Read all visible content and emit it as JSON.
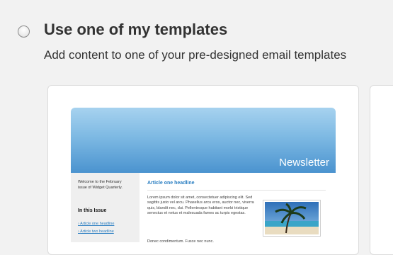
{
  "option": {
    "title": "Use one of my templates",
    "subtitle": "Add content to one of your pre-designed email templates"
  },
  "template_preview": {
    "header_title": "Newsletter",
    "sidebar": {
      "welcome": "Welcome to the February issue of Widget Quarterly.",
      "in_this_issue": "In this Issue",
      "links": [
        "Article one headline",
        "Article two headline"
      ]
    },
    "article": {
      "headline": "Article one headline",
      "body": "Lorem ipsum dolor sit amet, consectetuer adipiscing elit. Sed sagittis justo vel arcu. Phasellus arcu eros, auctor nec, viverra quis, blandit nec, dui. Pellentesque habitant morbi tristique senectus et netus et malesuada fames ac turpis egestas.",
      "body2": "Donec condimentum. Fusce nec nunc."
    },
    "photo_icon": "beach-palm-photo"
  },
  "colors": {
    "header_gradient_top": "#a7d2ef",
    "header_gradient_bottom": "#4b93cf",
    "link": "#2b7fc2"
  }
}
